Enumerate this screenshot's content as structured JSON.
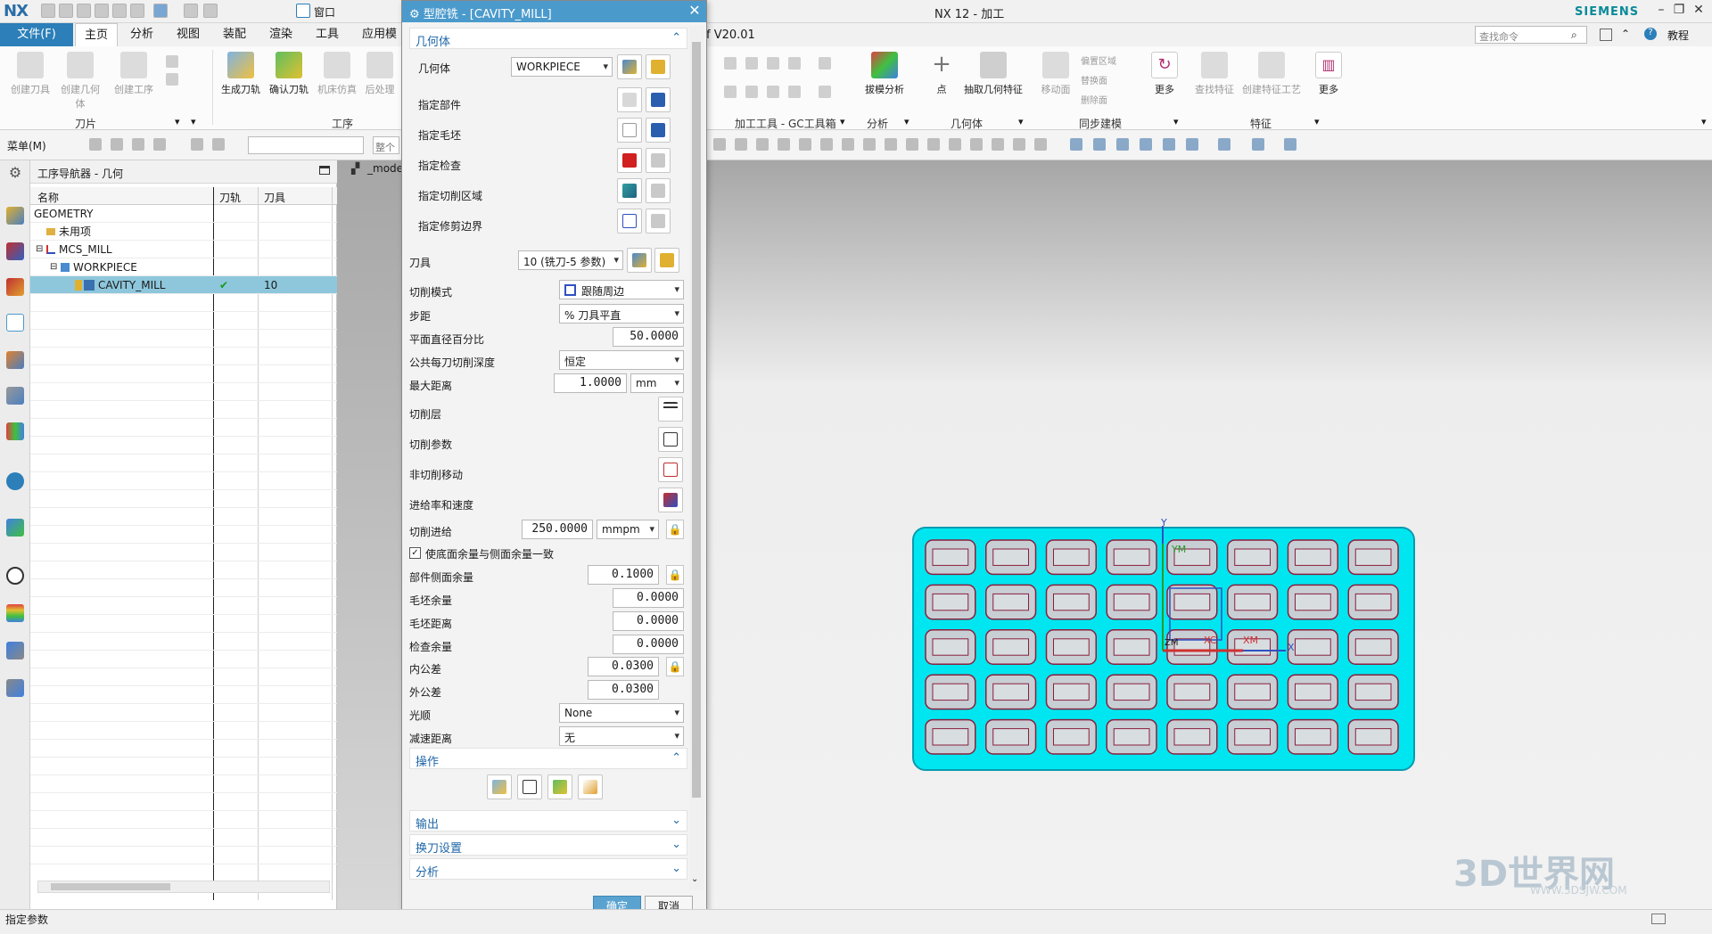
{
  "window": {
    "title": "NX 12 - 加工",
    "logo": "NX",
    "brand": "SIEMENS",
    "quick_window": "窗口"
  },
  "ribbon": {
    "file_tab": "文件(F)",
    "tabs": [
      "主页",
      "分析",
      "视图",
      "装配",
      "渲染",
      "工具",
      "应用模"
    ],
    "version": "f V20.01",
    "search_placeholder": "查找命令",
    "tutorial": "教程",
    "left_buttons": [
      "创建刀具",
      "创建几何体",
      "创建工序"
    ],
    "mid_buttons": [
      "生成刀轨",
      "确认刀轨",
      "机床仿真",
      "后处理"
    ],
    "right_buttons": [
      "拔模分析",
      "点",
      "抽取几何特征",
      "移动面",
      "更多",
      "查找特征",
      "创建特征工艺",
      "更多"
    ],
    "small_right": [
      "偏置区域",
      "替换面",
      "删除面"
    ],
    "groups": [
      "刀片",
      "工序",
      "加工工具 - GC工具箱",
      "分析",
      "几何体",
      "同步建模",
      "特征"
    ]
  },
  "selbar": {
    "menu": "菜单(M)",
    "filter_hint": "整个"
  },
  "navigator": {
    "title": "工序导航器 - 几何",
    "columns": [
      "名称",
      "刀轨",
      "刀具"
    ],
    "rows": [
      {
        "name": "GEOMETRY",
        "path": "",
        "tool": ""
      },
      {
        "name": "未用项",
        "path": "",
        "tool": ""
      },
      {
        "name": "MCS_MILL",
        "path": "",
        "tool": ""
      },
      {
        "name": "WORKPIECE",
        "path": "",
        "tool": ""
      },
      {
        "name": "CAVITY_MILL",
        "path": "✔",
        "tool": "10"
      }
    ]
  },
  "viewport": {
    "model_tab": "_mode",
    "axis_labels": [
      "Y",
      "YM",
      "X",
      "XC",
      "XM",
      "ZM"
    ]
  },
  "dialog": {
    "title": "型腔铣 - [CAVITY_MILL]",
    "geometry_section": "几何体",
    "geometry_label": "几何体",
    "geometry_value": "WORKPIECE",
    "specify_rows": [
      "指定部件",
      "指定毛坯",
      "指定检查",
      "指定切削区域",
      "指定修剪边界"
    ],
    "tool_label": "刀具",
    "tool_value": "10 (铣刀-5 参数)",
    "cut_pattern_label": "切削模式",
    "cut_pattern_value": "跟随周边",
    "stepover_label": "步距",
    "stepover_value": "% 刀具平直",
    "flat_pct_label": "平面直径百分比",
    "flat_pct_value": "50.0000",
    "depth_label": "公共每刀切削深度",
    "depth_value": "恒定",
    "max_dist_label": "最大距离",
    "max_dist_value": "1.0000",
    "max_dist_unit": "mm",
    "cut_levels": "切削层",
    "cut_params": "切削参数",
    "non_cut": "非切削移动",
    "feeds": "进给率和速度",
    "feed_label": "切削进给",
    "feed_value": "250.0000",
    "feed_unit": "mmpm",
    "same_stock_check": "使底面余量与侧面余量一致",
    "part_side_label": "部件侧面余量",
    "part_side_value": "0.1000",
    "blank_stock_label": "毛坯余量",
    "blank_stock_value": "0.0000",
    "blank_dist_label": "毛坯距离",
    "blank_dist_value": "0.0000",
    "check_stock_label": "检查余量",
    "check_stock_value": "0.0000",
    "intol_label": "内公差",
    "intol_value": "0.0300",
    "outtol_label": "外公差",
    "outtol_value": "0.0300",
    "smooth_label": "光顺",
    "smooth_value": "None",
    "slowdown_label": "减速距离",
    "slowdown_value": "无",
    "actions_section": "操作",
    "output_section": "输出",
    "toolchange_section": "换刀设置",
    "analysis_section": "分析",
    "ok": "确定",
    "cancel": "取消"
  },
  "status": {
    "text": "指定参数"
  },
  "watermark": {
    "brand": "3D世界网",
    "url": "WWW.3DSJW.COM"
  },
  "colors": {
    "accent": "#4b9acc",
    "file_tab": "#2c7fb8",
    "toolpath": "#00e6f0",
    "pocket": "#8a1f3d"
  }
}
